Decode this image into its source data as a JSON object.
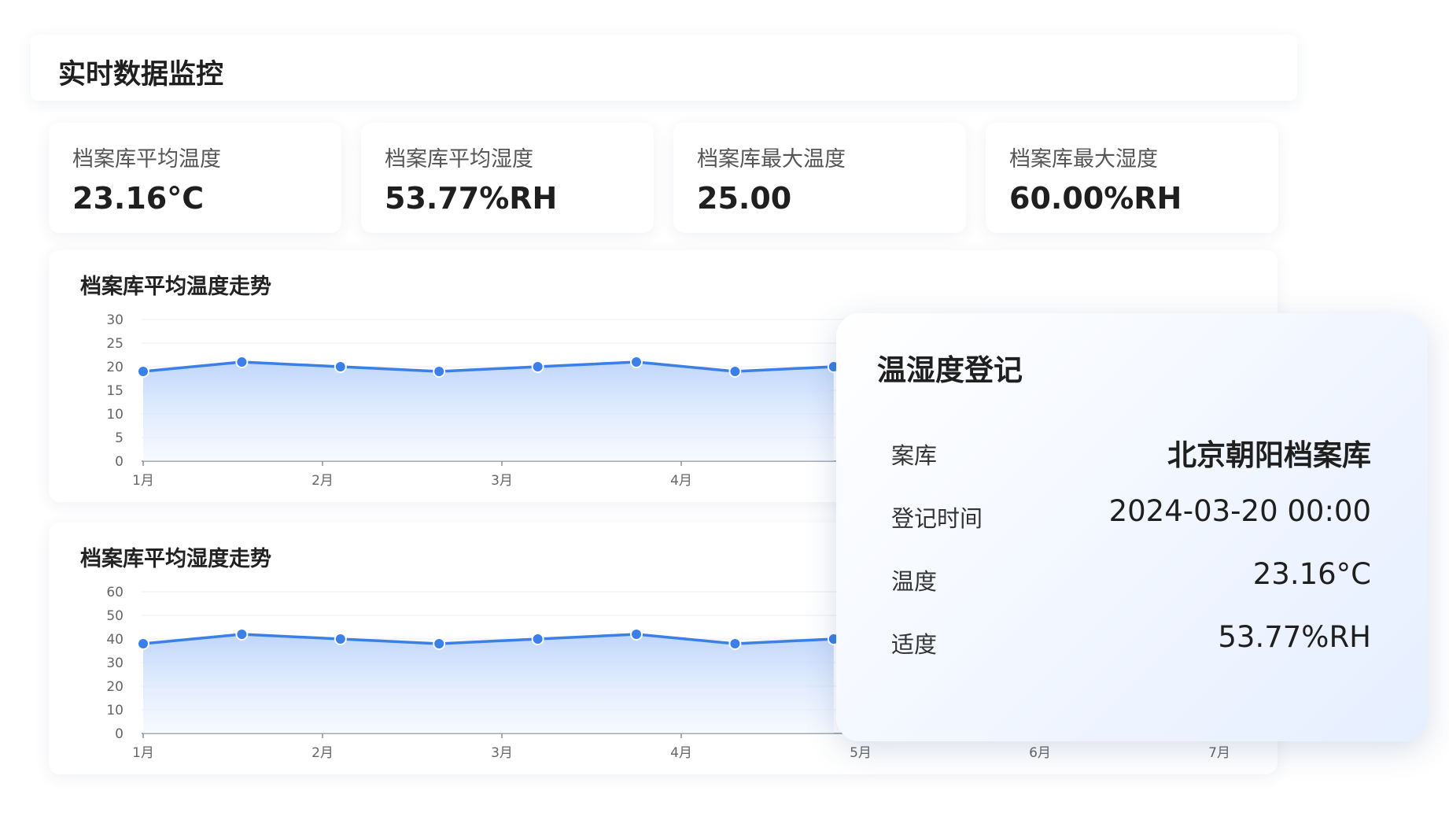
{
  "page": {
    "title": "实时数据监控"
  },
  "stats": [
    {
      "label": "档案库平均温度",
      "value": "23.16°C"
    },
    {
      "label": "档案库平均湿度",
      "value": "53.77%RH"
    },
    {
      "label": "档案库最大温度",
      "value": "25.00"
    },
    {
      "label": "档案库最大湿度",
      "value": "60.00%RH"
    }
  ],
  "charts": [
    {
      "title": "档案库平均温度走势"
    },
    {
      "title": "档案库平均湿度走势"
    }
  ],
  "chart_data": [
    {
      "type": "area",
      "title": "档案库平均温度走势",
      "x_ticks": [
        "1月",
        "2月",
        "3月",
        "4月"
      ],
      "y_ticks": [
        0,
        5,
        10,
        15,
        20,
        25,
        30
      ],
      "ylim": [
        0,
        30
      ],
      "grid": true,
      "x": [
        1.0,
        1.55,
        2.1,
        2.65,
        3.2,
        3.75,
        4.3,
        4.85
      ],
      "values": [
        19,
        21,
        20,
        19,
        20,
        21,
        19,
        20
      ],
      "color": "#3b7fe8"
    },
    {
      "type": "area",
      "title": "档案库平均湿度走势",
      "x_ticks": [
        "1月",
        "2月",
        "3月",
        "4月",
        "5月",
        "6月",
        "7月"
      ],
      "y_ticks": [
        0,
        10,
        20,
        30,
        40,
        50,
        60
      ],
      "ylim": [
        0,
        60
      ],
      "grid": true,
      "x": [
        1.0,
        1.55,
        2.1,
        2.65,
        3.2,
        3.75,
        4.3,
        4.85
      ],
      "values": [
        38,
        42,
        40,
        38,
        40,
        42,
        38,
        40
      ],
      "color": "#3b7fe8"
    }
  ],
  "popup": {
    "title": "温湿度登记",
    "rows": [
      {
        "label": "案库",
        "value": "北京朝阳档案库"
      },
      {
        "label": "登记时间",
        "value": "2024-03-20 00:00"
      },
      {
        "label": "温度",
        "value": "23.16°C"
      },
      {
        "label": "适度",
        "value": "53.77%RH"
      }
    ]
  }
}
